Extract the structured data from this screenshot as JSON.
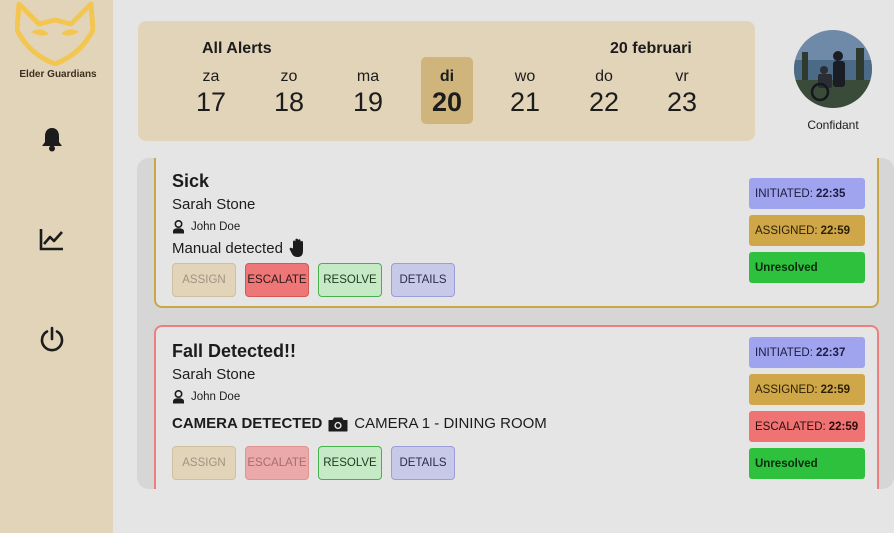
{
  "brand": {
    "name": "Elder Guardians",
    "accent": "#f3c651"
  },
  "calendar": {
    "title": "All Alerts",
    "current_date": "20 februari",
    "days": [
      {
        "name": "za",
        "num": "17",
        "active": false
      },
      {
        "name": "zo",
        "num": "18",
        "active": false
      },
      {
        "name": "ma",
        "num": "19",
        "active": false
      },
      {
        "name": "di",
        "num": "20",
        "active": true
      },
      {
        "name": "wo",
        "num": "21",
        "active": false
      },
      {
        "name": "do",
        "num": "22",
        "active": false
      },
      {
        "name": "vr",
        "num": "23",
        "active": false
      }
    ]
  },
  "profile": {
    "label": "Confidant"
  },
  "buttons": {
    "assign": "ASSIGN",
    "escalate": "ESCALATE",
    "resolve": "RESOLVE",
    "details": "DETAILS"
  },
  "alerts": [
    {
      "title": "Sick",
      "person": "Sarah Stone",
      "handler": "John Doe",
      "method": "Manual detected",
      "method_icon": "hand-icon",
      "statuses": {
        "initiated_label": "INITIATED:",
        "initiated_time": "22:35",
        "assigned_label": "ASSIGNED:",
        "assigned_time": "22:59",
        "state": "Unresolved"
      }
    },
    {
      "title": "Fall Detected!!",
      "person": "Sarah Stone",
      "handler": "John Doe",
      "method": "CAMERA DETECTED",
      "method_icon": "camera-icon",
      "camera": "CAMERA 1 - DINING ROOM",
      "statuses": {
        "initiated_label": "INITIATED:",
        "initiated_time": "22:37",
        "assigned_label": "ASSIGNED:",
        "assigned_time": "22:59",
        "escalated_label": "ESCALATED:",
        "escalated_time": "22:59",
        "state": "Unresolved"
      }
    }
  ]
}
